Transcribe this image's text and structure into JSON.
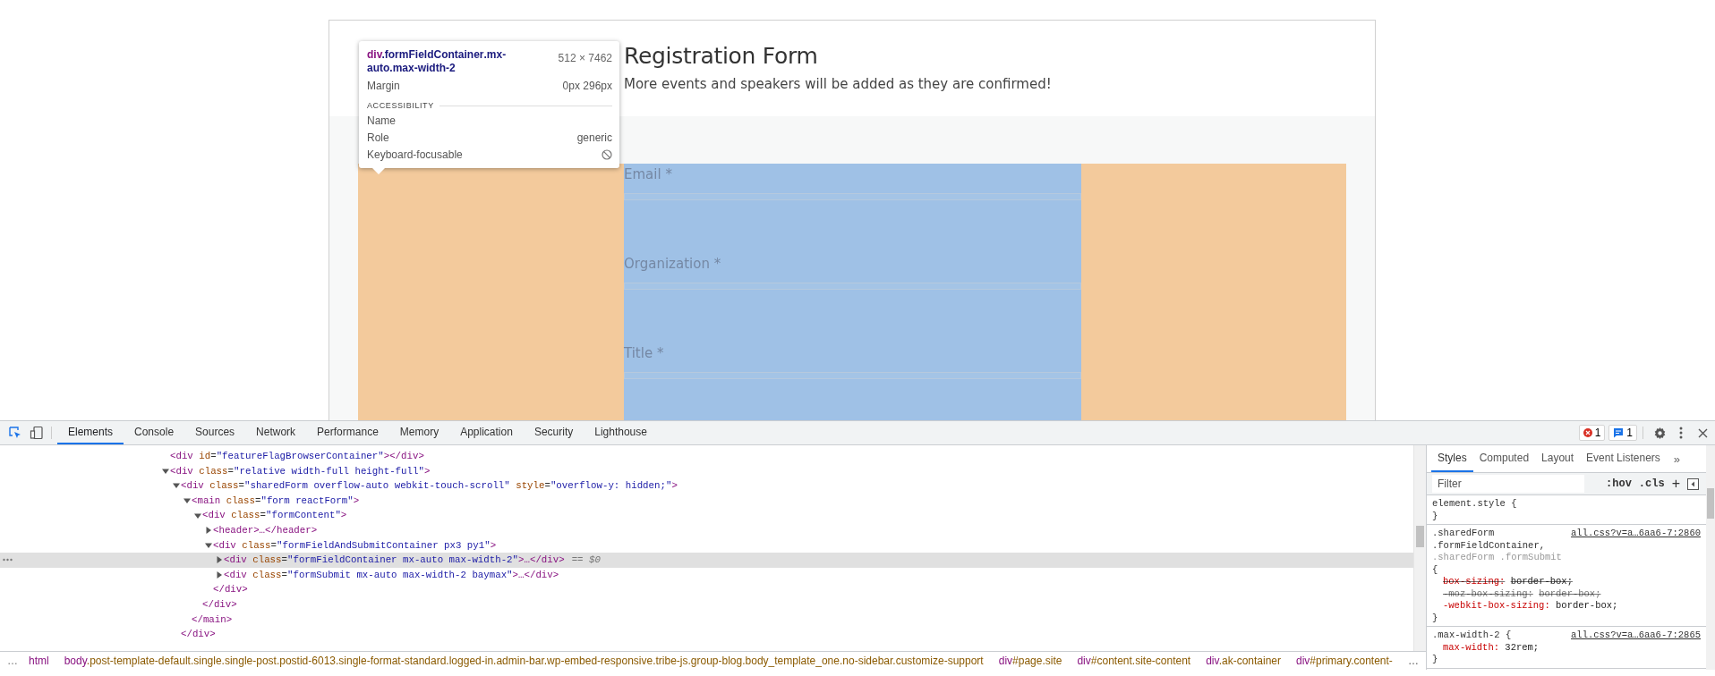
{
  "page": {
    "title": "Registration Form",
    "subtitle": "More events and speakers will be added as they are confirmed!",
    "fields": [
      {
        "label": "Email *"
      },
      {
        "label": "Organization *"
      },
      {
        "label": "Title *"
      }
    ]
  },
  "tooltip": {
    "selector": "div.formFieldContainer.mx-auto.max-width-2",
    "size": "512 × 7462",
    "rows": [
      {
        "label": "Margin",
        "value": "0px 296px"
      }
    ],
    "section": "ACCESSIBILITY",
    "accessibility": [
      {
        "kind": "text",
        "label": "Name"
      },
      {
        "kind": "text",
        "label": "Role",
        "value": "generic"
      },
      {
        "kind": "focusable",
        "label": "Keyboard-focusable",
        "focusable": false
      }
    ]
  },
  "devtools": {
    "tabs": [
      {
        "label": "Elements",
        "selected": true
      },
      {
        "label": "Console",
        "selected": false
      },
      {
        "label": "Sources",
        "selected": false
      },
      {
        "label": "Network",
        "selected": false
      },
      {
        "label": "Performance",
        "selected": false
      },
      {
        "label": "Memory",
        "selected": false
      },
      {
        "label": "Application",
        "selected": false
      },
      {
        "label": "Security",
        "selected": false
      },
      {
        "label": "Lighthouse",
        "selected": false
      }
    ],
    "badges": [
      {
        "kind": "error",
        "count": "1"
      },
      {
        "kind": "message",
        "count": "1"
      }
    ],
    "tree": [
      {
        "markup": "<div id=\"featureFlagBrowserContainer\"></div>",
        "selected": false
      },
      {
        "markup": "<div class=\"relative width-full height-full\">",
        "expanded": true,
        "selected": false,
        "children": [
          {
            "markup": "<div class=\"sharedForm overflow-auto webkit-touch-scroll\" style=\"overflow-y: hidden;\">",
            "expanded": true,
            "selected": false,
            "closing": "</div>",
            "children": [
              {
                "markup": "<main class=\"form reactForm\">",
                "expanded": true,
                "selected": false,
                "closing": "</main>",
                "children": [
                  {
                    "markup": "<div class=\"formContent\">",
                    "expanded": true,
                    "selected": false,
                    "closing": "</div>",
                    "children": [
                      {
                        "markup": "<header>…</header>",
                        "expanded": false,
                        "selected": false
                      },
                      {
                        "markup": "<div class=\"formFieldAndSubmitContainer px3 py1\">",
                        "expanded": true,
                        "selected": false,
                        "closing": "</div>",
                        "children": [
                          {
                            "markup": "<div class=\"formFieldContainer mx-auto max-width-2\">…</div>",
                            "expanded": false,
                            "selected": true,
                            "suffix": "== $0"
                          },
                          {
                            "markup": "<div class=\"formSubmit mx-auto max-width-2 baymax\">…</div>",
                            "expanded": false,
                            "selected": false
                          }
                        ]
                      }
                    ]
                  }
                ]
              }
            ]
          }
        ]
      }
    ],
    "breadcrumb_lead": "…",
    "breadcrumbs": [
      {
        "text": "html"
      },
      {
        "text": "body.post-template-default.single.single-post.postid-6013.single-format-standard.logged-in.admin-bar.wp-embed-responsive.tribe-js.group-blog.body_template_one.no-sidebar.customize-support"
      },
      {
        "text": "div#page.site"
      },
      {
        "text": "div#content.site-content"
      },
      {
        "text": "div.ak-container"
      },
      {
        "text": "div#primary.content-"
      }
    ],
    "breadcrumb_trail": "…"
  },
  "styles": {
    "tabs": [
      {
        "label": "Styles",
        "selected": true
      },
      {
        "label": "Computed",
        "selected": false
      },
      {
        "label": "Layout",
        "selected": false
      },
      {
        "label": "Event Listeners",
        "selected": false
      }
    ],
    "more": "»",
    "filter": {
      "placeholder": "Filter"
    },
    "hov": ":hov",
    "cls": ".cls",
    "add": "+",
    "rules": [
      {
        "selectors": [
          {
            "text": "element.style",
            "matched": true
          }
        ],
        "open": "{",
        "close": "}"
      },
      {
        "selectors": [
          {
            "text": ".sharedForm .formFieldContainer,",
            "matched": true
          },
          {
            "text": ".sharedForm .formSubmit",
            "matched": false
          }
        ],
        "source": "all.css?v=a…6aa6-7:2860",
        "open": "{",
        "close": "}",
        "declarations": [
          {
            "property": "box-sizing:",
            "value": "border-box;",
            "overridden": true,
            "dimmed": false
          },
          {
            "property": "-moz-box-sizing:",
            "value": "border-box;",
            "overridden": true,
            "dimmed": true
          },
          {
            "property": "-webkit-box-sizing:",
            "value": "border-box;",
            "overridden": false,
            "dimmed": false
          }
        ]
      },
      {
        "selectors": [
          {
            "text": ".max-width-2",
            "matched": true
          }
        ],
        "source": "all.css?v=a…6aa6-7:2865",
        "open": "{",
        "close": "}",
        "declarations": [
          {
            "property": "max-width:",
            "value": "32rem;",
            "overridden": false,
            "dimmed": false
          }
        ]
      }
    ]
  }
}
